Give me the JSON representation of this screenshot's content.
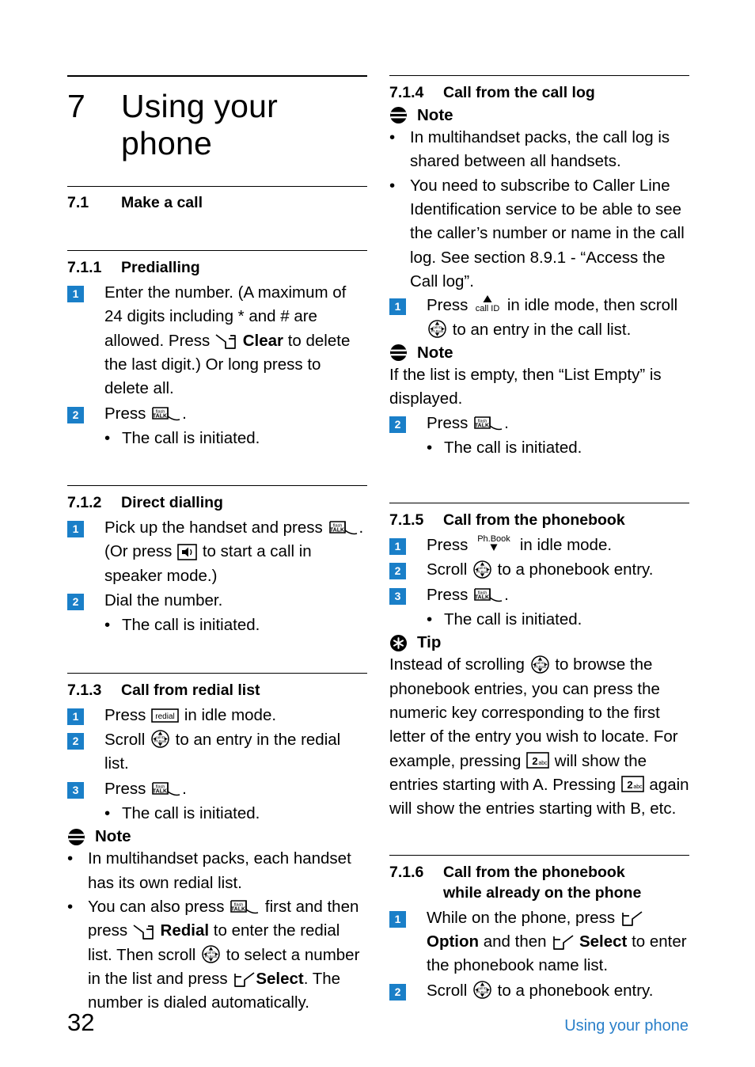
{
  "chapter": {
    "number": "7",
    "title": "Using your phone"
  },
  "section_71": {
    "number": "7.1",
    "title": "Make a call"
  },
  "sections": {
    "s711": {
      "number": "7.1.1",
      "title": "Predialling",
      "step1_a": "Enter the number. (A maximum of 24 digits including * and # are allowed. Press",
      "step1_b": "Clear",
      "step1_c": "to delete the last digit.) Or long press to delete all.",
      "step2_a": "Press",
      "step2_b": ".",
      "step2_bullet": "The call is initiated."
    },
    "s712": {
      "number": "7.1.2",
      "title": "Direct dialling",
      "step1_a": "Pick up the handset and press",
      "step1_b": ". (Or press",
      "step1_c": "to start a call in speaker mode.)",
      "step2": "Dial the number.",
      "step2_bullet": "The call is initiated."
    },
    "s713": {
      "number": "7.1.3",
      "title": "Call from redial list",
      "step1_a": "Press",
      "step1_b": "in idle mode.",
      "step2_a": "Scroll",
      "step2_b": "to an entry in the redial list.",
      "step3_a": "Press",
      "step3_b": ".",
      "step3_bullet": "The call is initiated.",
      "note_label": "Note",
      "note_b1": "In multihandset packs, each handset has its own redial list.",
      "note_b2_a": "You can also press",
      "note_b2_b": "first and then press",
      "note_b2_c": "Redial",
      "note_b2_d": "to enter the redial list. Then scroll",
      "note_b2_e": "to select a number in the list and press",
      "note_b2_f": "Select",
      "note_b2_g": ". The number is dialed automatically."
    },
    "s714": {
      "number": "7.1.4",
      "title": "Call from the call log",
      "note_label": "Note",
      "note_b1": "In multihandset packs, the call log is shared between all handsets.",
      "note_b2": "You need to subscribe to Caller Line Identification service to be able to see the caller’s number or name in the call log. See section 8.9.1 - “Access the Call log”.",
      "step1_a": "Press",
      "step1_b": "in idle mode, then scroll",
      "step1_c": "to an entry in the call list.",
      "note2_label": "Note",
      "note2_text": "If the list is empty, then “List Empty” is displayed.",
      "step2_a": "Press",
      "step2_b": ".",
      "step2_bullet": "The call is initiated."
    },
    "s715": {
      "number": "7.1.5",
      "title": "Call from the phonebook",
      "step1_a": "Press",
      "step1_b": "in idle mode.",
      "step2_a": "Scroll",
      "step2_b": "to a phonebook entry.",
      "step3_a": "Press",
      "step3_b": ".",
      "step3_bullet": "The call is initiated.",
      "tip_label": "Tip",
      "tip_a": "Instead of scrolling",
      "tip_b": "to browse the phonebook entries, you can press the numeric key corresponding to the first letter of the entry you wish to locate. For example, pressing",
      "tip_c": "will show the entries starting with A. Pressing",
      "tip_d": "again will show the entries starting with B, etc."
    },
    "s716": {
      "number": "7.1.6",
      "title_line1": "Call from the phonebook",
      "title_line2": "while already on the phone",
      "step1_a": "While on the phone, press",
      "step1_b": "Option",
      "step1_c": "and then",
      "step1_d": "Select",
      "step1_e": "to enter the phonebook name list.",
      "step2_a": "Scroll",
      "step2_b": "to a phonebook entry."
    }
  },
  "badges": {
    "one": "1",
    "two": "2",
    "three": "3"
  },
  "bullet_char": "•",
  "keys": {
    "softkey_left": "left-softkey",
    "softkey_right": "right-softkey",
    "talk": "flash-talk-key",
    "talk_top_label": "flash",
    "talk_label": "TALK",
    "speaker": "speaker-key",
    "redial": "redial-key",
    "redial_label": "redial",
    "nav": "navigation-scroll-key",
    "nav_up_label": "call ID",
    "nav_down_label": "Ph.Book",
    "callid": "call-id-key",
    "callid_label": "call ID",
    "phbook": "phonebook-key",
    "phbook_label": "Ph.Book",
    "key2": "numeric-key-2",
    "key2_digit": "2",
    "key2_letters": "abc"
  },
  "footer": {
    "page_number": "32",
    "running_title": "Using your phone"
  },
  "colors": {
    "badge_blue": "#1a7fc8",
    "footer_blue": "#2a7fc9",
    "text": "#000000"
  }
}
